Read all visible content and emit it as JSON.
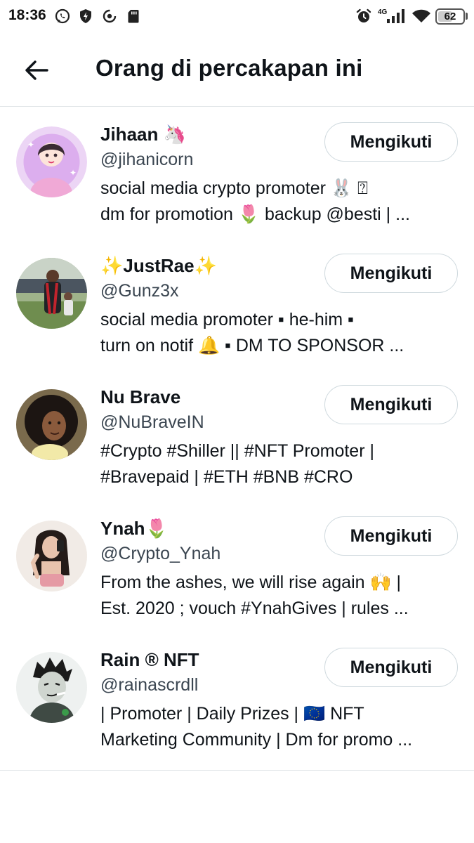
{
  "status_bar": {
    "time": "18:36",
    "network": "4G",
    "battery": "62",
    "battery_level_percent": 62,
    "icons": [
      "whatsapp-icon",
      "shield-icon",
      "sync-icon",
      "sd-card-icon",
      "alarm-icon",
      "signal-icon",
      "wifi-icon",
      "battery-icon"
    ]
  },
  "header": {
    "title": "Orang di percakapan ini",
    "back_icon": "arrow-left-icon"
  },
  "people": [
    {
      "name": "Jihaan 🦄",
      "handle": "@jihanicorn",
      "bio": [
        "social media crypto promoter 🐰 ⍰",
        "dm for promotion 🌷 backup @besti | ..."
      ],
      "button": "Mengikuti",
      "avatar_colors": [
        "#e9c6f2",
        "#b56fd1"
      ]
    },
    {
      "name": "✨JustRae✨",
      "handle": "@Gunz3x",
      "bio": [
        "social media promoter  ▪  he-him  ▪",
        "turn on notif 🔔  ▪  DM TO SPONSOR ..."
      ],
      "button": "Mengikuti",
      "avatar_colors": [
        "#6b7d5a",
        "#2a2f33"
      ]
    },
    {
      "name": "Nu Brave",
      "handle": "@NuBraveIN",
      "bio": [
        "#Crypto #Shiller || #NFT Promoter |",
        "#Bravepaid | #ETH #BNB #CRO"
      ],
      "button": "Mengikuti",
      "avatar_colors": [
        "#6e5a3e",
        "#1d1714"
      ]
    },
    {
      "name": "Ynah🌷",
      "handle": "@Crypto_Ynah",
      "bio": [
        "From the ashes, we will rise again 🙌 |",
        "Est. 2020 ; vouch #YnahGives | rules ..."
      ],
      "button": "Mengikuti",
      "avatar_colors": [
        "#efe3dc",
        "#c8a08e"
      ]
    },
    {
      "name": "Rain ® NFT",
      "handle": "@rainascrdll",
      "bio": [
        "| Promoter | Daily Prizes | 🇪🇺 NFT",
        "Marketing Community | Dm for promo ..."
      ],
      "button": "Mengikuti",
      "avatar_colors": [
        "#f1f3f2",
        "#55655c"
      ]
    }
  ]
}
